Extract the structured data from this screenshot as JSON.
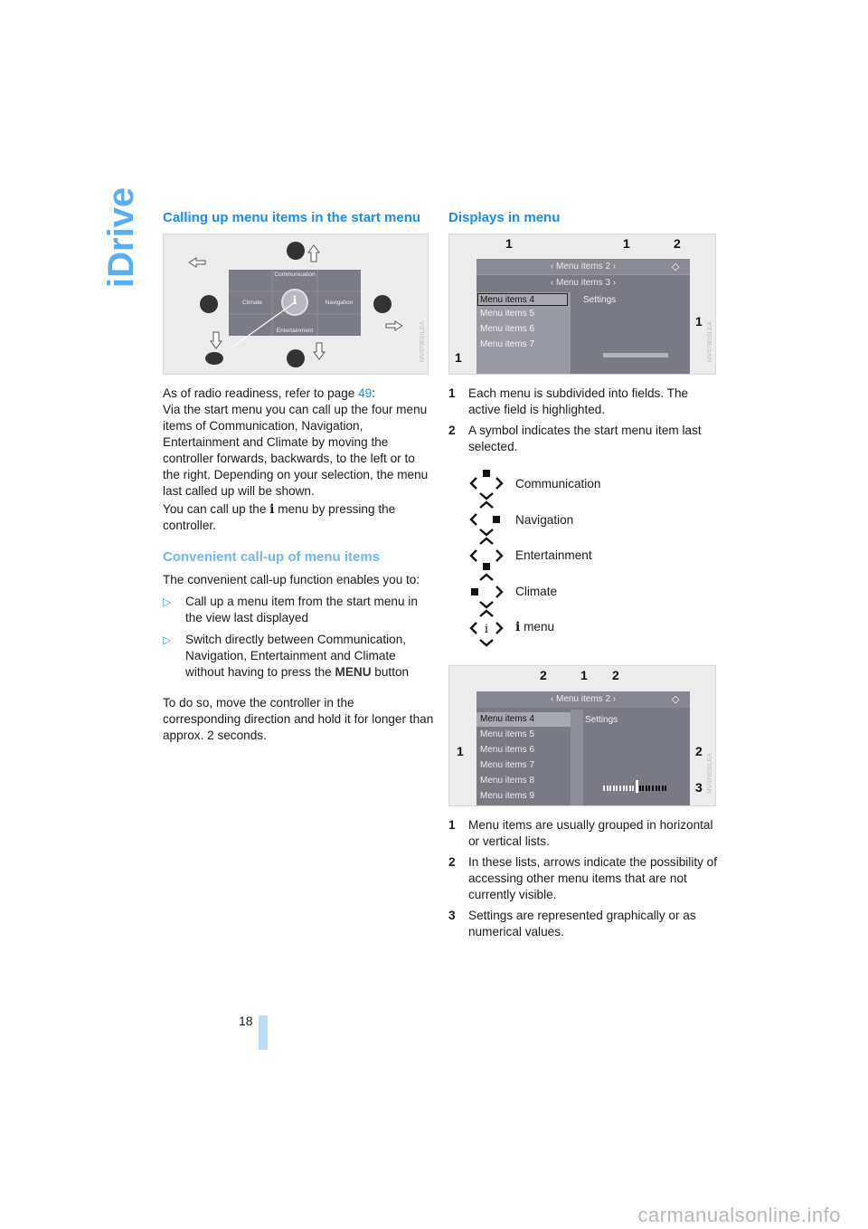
{
  "side_title": "iDrive",
  "left_column": {
    "heading1": "Calling up menu items in the start menu",
    "figure1": {
      "labels": {
        "top": "Communication",
        "left": "Climate",
        "right": "Navigation",
        "bottom": "Entertainment",
        "center": "i"
      },
      "code": "MV07801ILEA"
    },
    "para1_prefix": "As of radio readiness, refer to page ",
    "para1_link": "49",
    "para1_suffix": ":",
    "para2": "Via the start menu you can call up the four menu items of Communication, Navigation, Entertainment and Climate by moving the controller forwards, backwards, to the left or to the right. Depending on your selection, the menu last called up will be shown.",
    "para3_prefix": "You can call up the ",
    "para3_icon": "i",
    "para3_suffix": " menu by pressing the controller.",
    "heading2": "Convenient call-up of menu items",
    "para4": "The convenient call-up function enables you to:",
    "bullets": [
      {
        "marker": "▷",
        "text": "Call up a menu item from the start menu in the view last displayed"
      },
      {
        "marker": "▷",
        "text_prefix": "Switch directly between Communication, Navigation, Entertainment and Climate without having to press the ",
        "menu_label": "MENU",
        "text_suffix": " button"
      }
    ],
    "para5": "To do so, move the controller in the corresponding direction and hold it for longer than approx. 2 seconds."
  },
  "right_column": {
    "heading": "Displays in menu",
    "figure2": {
      "callouts": [
        "1",
        "1",
        "2",
        "1",
        "1"
      ],
      "row1": "‹ Menu items 2 ›",
      "row2": "‹ Menu items 3 ›",
      "list": [
        "Menu items 4",
        "Menu items 5",
        "Menu items 6",
        "Menu items 7"
      ],
      "settings": "Settings",
      "code": "MV07802ILEA"
    },
    "list1": [
      {
        "n": "1",
        "text": "Each menu is subdivided into fields. The active field is highlighted."
      },
      {
        "n": "2",
        "text": "A symbol indicates the start menu item last selected."
      }
    ],
    "symbols": [
      {
        "icon": "communication-symbol",
        "label": "Communication"
      },
      {
        "icon": "navigation-symbol",
        "label": "Navigation"
      },
      {
        "icon": "entertainment-symbol",
        "label": "Entertainment"
      },
      {
        "icon": "climate-symbol",
        "label": "Climate"
      },
      {
        "icon": "i-menu-symbol",
        "label": " menu",
        "label_icon": "i"
      }
    ],
    "figure3": {
      "callouts_top": [
        "2",
        "1",
        "2"
      ],
      "callout_left": "1",
      "callout_right_mid": "2",
      "callout_right_bottom": "3",
      "header": "‹ Menu items 2 ›",
      "list": [
        "Menu items 4",
        "Menu items 5",
        "Menu items 6",
        "Menu items 7",
        "Menu items 8",
        "Menu items 9"
      ],
      "settings": "Settings",
      "slider_value": 0.5,
      "code": "MV07803ILEA"
    },
    "list2": [
      {
        "n": "1",
        "text": "Menu items are usually grouped in horizontal or vertical lists."
      },
      {
        "n": "2",
        "text": "In these lists, arrows indicate the possibility of accessing other menu items that are not currently visible."
      },
      {
        "n": "3",
        "text": "Settings are represented graphically or as numerical values."
      }
    ]
  },
  "page_number": "18",
  "footer": "carmanualsonline.info",
  "colors": {
    "accent": "#1a8cf0",
    "accent_light": "#6bb8f5",
    "side_title": "#5aaef0",
    "page_bar": "#bcdcfa"
  }
}
